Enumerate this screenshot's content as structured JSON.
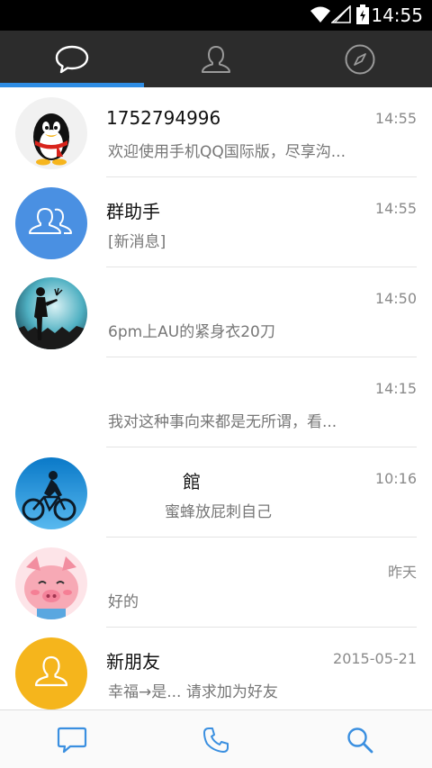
{
  "status_bar": {
    "time": "14:55",
    "icons": [
      "wifi-icon",
      "signal-icon",
      "battery-charging-icon"
    ]
  },
  "top_tabs": [
    {
      "icon": "chat-bubble-icon",
      "active": true
    },
    {
      "icon": "contacts-icon",
      "active": false
    },
    {
      "icon": "compass-icon",
      "active": false
    }
  ],
  "colors": {
    "accent": "#2f8de4",
    "tab_bar_bg": "#2c2c2c",
    "group_helper_avatar": "#4a90e2",
    "new_friend_avatar": "#f5b51c"
  },
  "conversations": [
    {
      "name": "1752794996",
      "time": "14:55",
      "preview": "欢迎使用手机QQ国际版，尽享沟..."
    },
    {
      "name": "群助手",
      "time": "14:55",
      "preview": "[新消息]"
    },
    {
      "name": "",
      "time": "14:50",
      "preview": "6pm上AU的紧身衣20刀"
    },
    {
      "name": "",
      "time": "14:15",
      "preview": "我对这种事向来都是无所谓，看..."
    },
    {
      "name": "館",
      "time": "10:16",
      "preview": "蜜蜂放屁刺自己"
    },
    {
      "name": "",
      "time": "昨天",
      "preview": "好的"
    },
    {
      "name": "新朋友",
      "time": "2015-05-21",
      "preview": "幸福→是... 请求加为好友"
    }
  ],
  "bottom_nav": [
    {
      "icon": "message-icon"
    },
    {
      "icon": "phone-icon"
    },
    {
      "icon": "search-icon"
    }
  ]
}
